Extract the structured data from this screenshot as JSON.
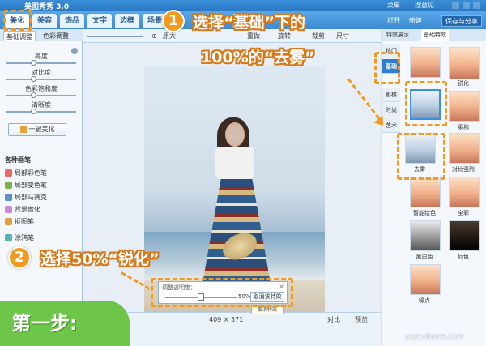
{
  "app": {
    "title": "美图秀秀 3.0",
    "menu_label": "菜单",
    "help_label": "搜意见"
  },
  "main_tabs": [
    {
      "label": "美化",
      "active": true
    },
    {
      "label": "美容"
    },
    {
      "label": "饰品"
    },
    {
      "label": "文字"
    },
    {
      "label": "边框"
    },
    {
      "label": "场景"
    },
    {
      "label": "拼图"
    }
  ],
  "top_actions": {
    "open_label": "打开",
    "new_label": "新建",
    "save_label": "保存与分享"
  },
  "left_panel": {
    "tabs": [
      "基础调整",
      "色彩调整"
    ],
    "sliders": [
      {
        "label": "亮度",
        "value": 0.5
      },
      {
        "label": "对比度",
        "value": 0.5
      },
      {
        "label": "色彩饱和度",
        "value": 0.5
      },
      {
        "label": "清晰度",
        "value": 0.5
      }
    ],
    "one_click_label": "一键美化",
    "brushes_title": "各种画笔",
    "brushes": [
      "局部彩色笔",
      "局部变色笔",
      "局部马赛克",
      "背景虚化",
      "抠图笔",
      "涂鸦笔"
    ]
  },
  "toolbar": {
    "zoom_label": "100%",
    "actual_size_label": "原大",
    "undo_label": "撤销",
    "redo_label": "重做",
    "rotate_label": "旋转",
    "crop_label": "裁剪",
    "resize_label": "尺寸"
  },
  "opacity_popup": {
    "title": "调整透明度：",
    "close": "×",
    "value_label": "50%",
    "value": 0.5,
    "cancel_label": "取消该特效",
    "tip": "取消特效"
  },
  "status": {
    "dimensions": "409 × 571",
    "compare_label": "对比",
    "preview_label": "预览"
  },
  "right_panel": {
    "tabs": [
      "特效展示",
      "基础特效"
    ],
    "categories": [
      {
        "label": "热门"
      },
      {
        "label": "基础",
        "active": true
      },
      {
        "label": "影楼"
      },
      {
        "label": "时尚"
      },
      {
        "label": "艺术"
      }
    ],
    "effects": [
      {
        "label": "",
        "tone": "warm"
      },
      {
        "label": "",
        "tone": "warm"
      },
      {
        "label": "",
        "tone": "cool",
        "selected": true
      },
      {
        "label": "锐化",
        "tone": "warm"
      },
      {
        "label": "去雾",
        "tone": "cool"
      },
      {
        "label": "柔和",
        "tone": "warm"
      },
      {
        "label": "",
        "tone": "warm"
      },
      {
        "label": "对比强烈",
        "tone": "warm"
      },
      {
        "label": "智能绘色",
        "tone": "warm"
      },
      {
        "label": "全彩",
        "tone": "warm"
      },
      {
        "label": "黑白色",
        "tone": "bw"
      },
      {
        "label": "反色",
        "tone": "dark"
      },
      {
        "label": "噪点",
        "tone": "warm"
      }
    ]
  },
  "annotations": {
    "step1_number": "1",
    "step1_line1": "选择“基础”下的",
    "step1_line2": "100%的“去雾”",
    "step2_number": "2",
    "step2_text": "选择50%“锐化”",
    "step_badge": "第一步:",
    "accent_color": "#f39a1e",
    "badge_color": "#6dc64a"
  },
  "watermark": "www.duote.com"
}
